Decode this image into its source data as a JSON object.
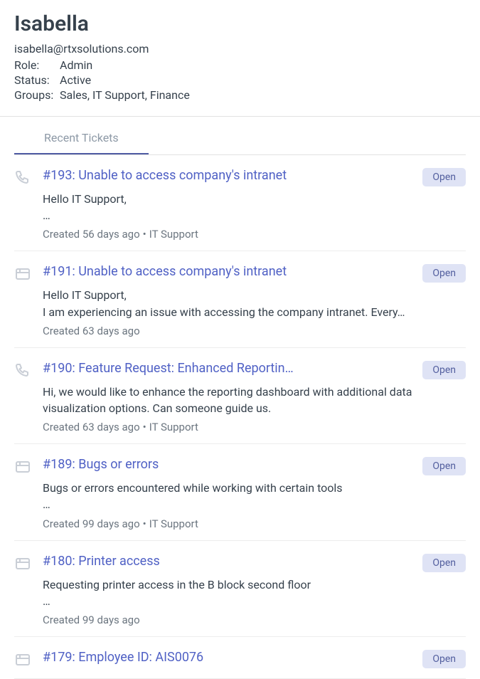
{
  "user": {
    "name": "Isabella",
    "email": "isabella@rtxsolutions.com",
    "role_label": "Role:",
    "role_value": "Admin",
    "status_label": "Status:",
    "status_value": "Active",
    "groups_label": "Groups:",
    "groups_value": "Sales, IT Support, Finance"
  },
  "tabs": {
    "recent_tickets": "Recent Tickets"
  },
  "badge": {
    "open": "Open"
  },
  "tickets": [
    {
      "icon": "phone",
      "title": "#193: Unable to access company's intranet",
      "desc": "Hello IT Support,\n…",
      "meta_created": "Created 56 days ago",
      "meta_group": "IT Support"
    },
    {
      "icon": "form",
      "title": "#191: Unable to access company's intranet",
      "desc": "Hello IT Support,\nI am experiencing an issue with accessing the company intranet. Every…",
      "meta_created": "Created 63 days ago",
      "meta_group": ""
    },
    {
      "icon": "phone",
      "title": "#190: Feature Request: Enhanced Reportin…",
      "desc": "Hi, we would like to enhance the reporting dashboard with additional data visualization options. Can someone guide us.",
      "meta_created": "Created 63 days ago",
      "meta_group": "IT Support"
    },
    {
      "icon": "form",
      "title": "#189: Bugs or errors",
      "desc": "Bugs or errors encountered while working with certain tools\n…",
      "meta_created": "Created 99 days ago",
      "meta_group": "IT Support"
    },
    {
      "icon": "form",
      "title": "#180: Printer access",
      "desc": "Requesting printer access in the B block second floor\n…",
      "meta_created": "Created 99 days ago",
      "meta_group": ""
    },
    {
      "icon": "form",
      "title": "#179: Employee ID: AIS0076",
      "desc": "",
      "meta_created": "",
      "meta_group": ""
    }
  ]
}
